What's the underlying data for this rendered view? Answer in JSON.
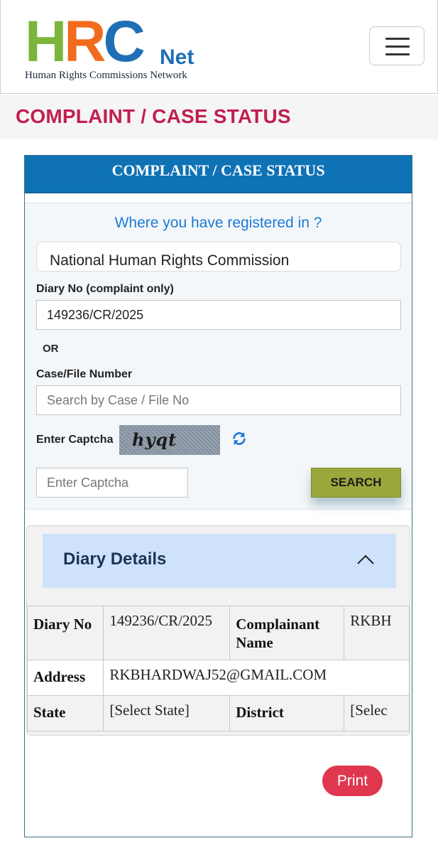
{
  "header": {
    "logo_letters_h": "H",
    "logo_letters_r": "R",
    "logo_letters_c": "C",
    "logo_net": "Net",
    "logo_tagline": "Human Rights Commissions Network",
    "menu_icon": "hamburger-icon"
  },
  "page_title": "COMPLAINT / CASE STATUS",
  "panel": {
    "title": "COMPLAINT / CASE STATUS",
    "question": "Where you have registered in ?",
    "commission_selected": "National Human Rights Commission",
    "diary_label": "Diary No (complaint only)",
    "diary_value": "149236/CR/2025",
    "or_text": "OR",
    "case_label": "Case/File Number",
    "case_placeholder": "Search by Case / File No",
    "captcha_label": "Enter Captcha",
    "captcha_text": "hyqt",
    "refresh_icon": "refresh-icon",
    "captcha_placeholder": "Enter Captcha",
    "search_label": "SEARCH"
  },
  "details": {
    "heading": "Diary Details",
    "chevron_icon": "chevron-up-icon",
    "rows": [
      {
        "h1": "Diary No",
        "v1": "149236/CR/2025",
        "h2": "Complainant Name",
        "v2": "RKBH"
      },
      {
        "h1": "Address",
        "v1": "RKBHARDWAJ52@GMAIL.COM"
      },
      {
        "h1": "State",
        "v1": "[Select State]",
        "h2": "District",
        "v2": "[Selec"
      }
    ]
  },
  "print_label": "Print",
  "colors": {
    "title_red": "#c21f4e",
    "panel_blue": "#0e72b5",
    "link_blue": "#1a7ad6",
    "search_olive": "#9aa83c",
    "print_red": "#e0374f",
    "accordion_bg": "#cfe2fb"
  }
}
